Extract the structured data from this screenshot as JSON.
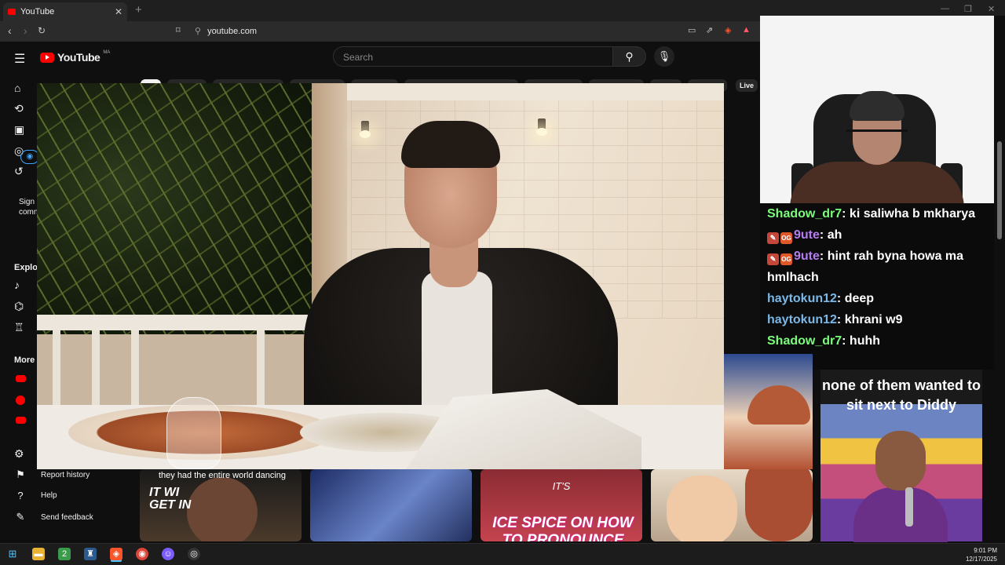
{
  "browser": {
    "tab_title": "YouTube",
    "tab_close": "✕",
    "new_tab": "+",
    "url": "youtube.com",
    "win_min": "—",
    "win_max": "❐",
    "win_close": "✕"
  },
  "masthead": {
    "logo_text": "YouTube",
    "country_code": "MA",
    "search_placeholder": "Search"
  },
  "chips": {
    "live_label": "Live"
  },
  "sidebar": {
    "signin_line1": "Sign i",
    "signin_line2": "comn",
    "explore_label": "Explor",
    "more_label": "More",
    "report_history": "Report history",
    "help": "Help",
    "send_feedback": "Send feedback"
  },
  "chat": {
    "messages": [
      {
        "user": "Shadow_dr7",
        "user_color": "#7cfc7c",
        "text": "ki saliwha b mkharya",
        "badges": false
      },
      {
        "user": "9ute",
        "user_color": "#b57cf0",
        "text": "ah",
        "badges": true
      },
      {
        "user": "9ute",
        "user_color": "#b57cf0",
        "text": "hint rah byna howa ma hmlhach",
        "badges": true
      },
      {
        "user": "haytokun12",
        "user_color": "#79b8e8",
        "text": "deep",
        "badges": false
      },
      {
        "user": "haytokun12",
        "user_color": "#79b8e8",
        "text": "khrani w9",
        "badges": false
      },
      {
        "user": "Shadow_dr7",
        "user_color": "#7cfc7c",
        "text": "huhh",
        "badges": false
      }
    ],
    "badge_og": "OG"
  },
  "shorts": {
    "s1_caption": "they had the entire world dancing",
    "s1_overlay": "IT WI GET IN",
    "s3_top": "IT'S",
    "s3_title": "ICE SPICE ON HOW TO PRONOUNCE HUSSEIN",
    "diddy_caption": "none of them wanted to sit next to Diddy"
  },
  "taskbar": {
    "time": "9:01 PM",
    "date": "12/17/2025"
  },
  "colors": {
    "yt_red": "#ff0000",
    "accent_blue": "#3ea6ff",
    "bg": "#0f0f0f"
  }
}
